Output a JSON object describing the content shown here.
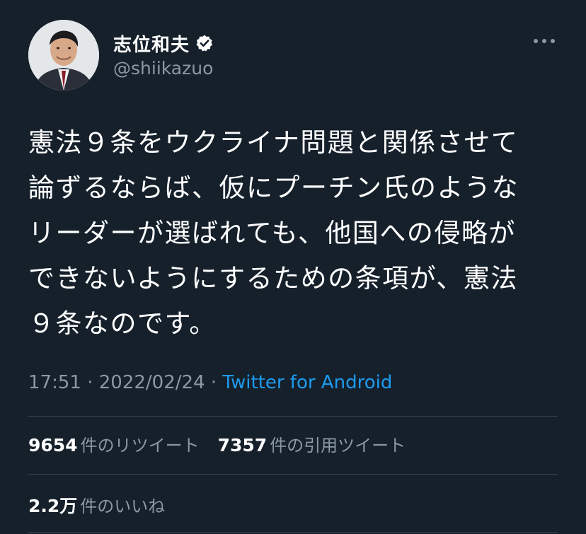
{
  "author": {
    "display_name": "志位和夫",
    "handle": "@shiikazuo",
    "verified": true,
    "avatar_icon": "profile-photo"
  },
  "tweet": {
    "lines": [
      "憲法９条をウクライナ問題と関係させて",
      "論ずるならば、仮にプーチン氏のような",
      "リーダーが選ばれても、他国への侵略が",
      "できないようにするための条項が、憲法",
      "９条なのです。"
    ]
  },
  "meta": {
    "time": "17:51",
    "separator": " · ",
    "date": "2022/02/24",
    "source": "Twitter for Android"
  },
  "stats": {
    "retweets_count": "9654",
    "retweets_label": "件のリツイート",
    "quotes_count": "7357",
    "quotes_label": "件の引用ツイート",
    "likes_count": "2.2万",
    "likes_label": "件のいいね"
  },
  "colors": {
    "background": "#15202b",
    "text": "#ffffff",
    "secondary": "#8b98a5",
    "link": "#1d9bf0",
    "divider": "#38444d"
  }
}
